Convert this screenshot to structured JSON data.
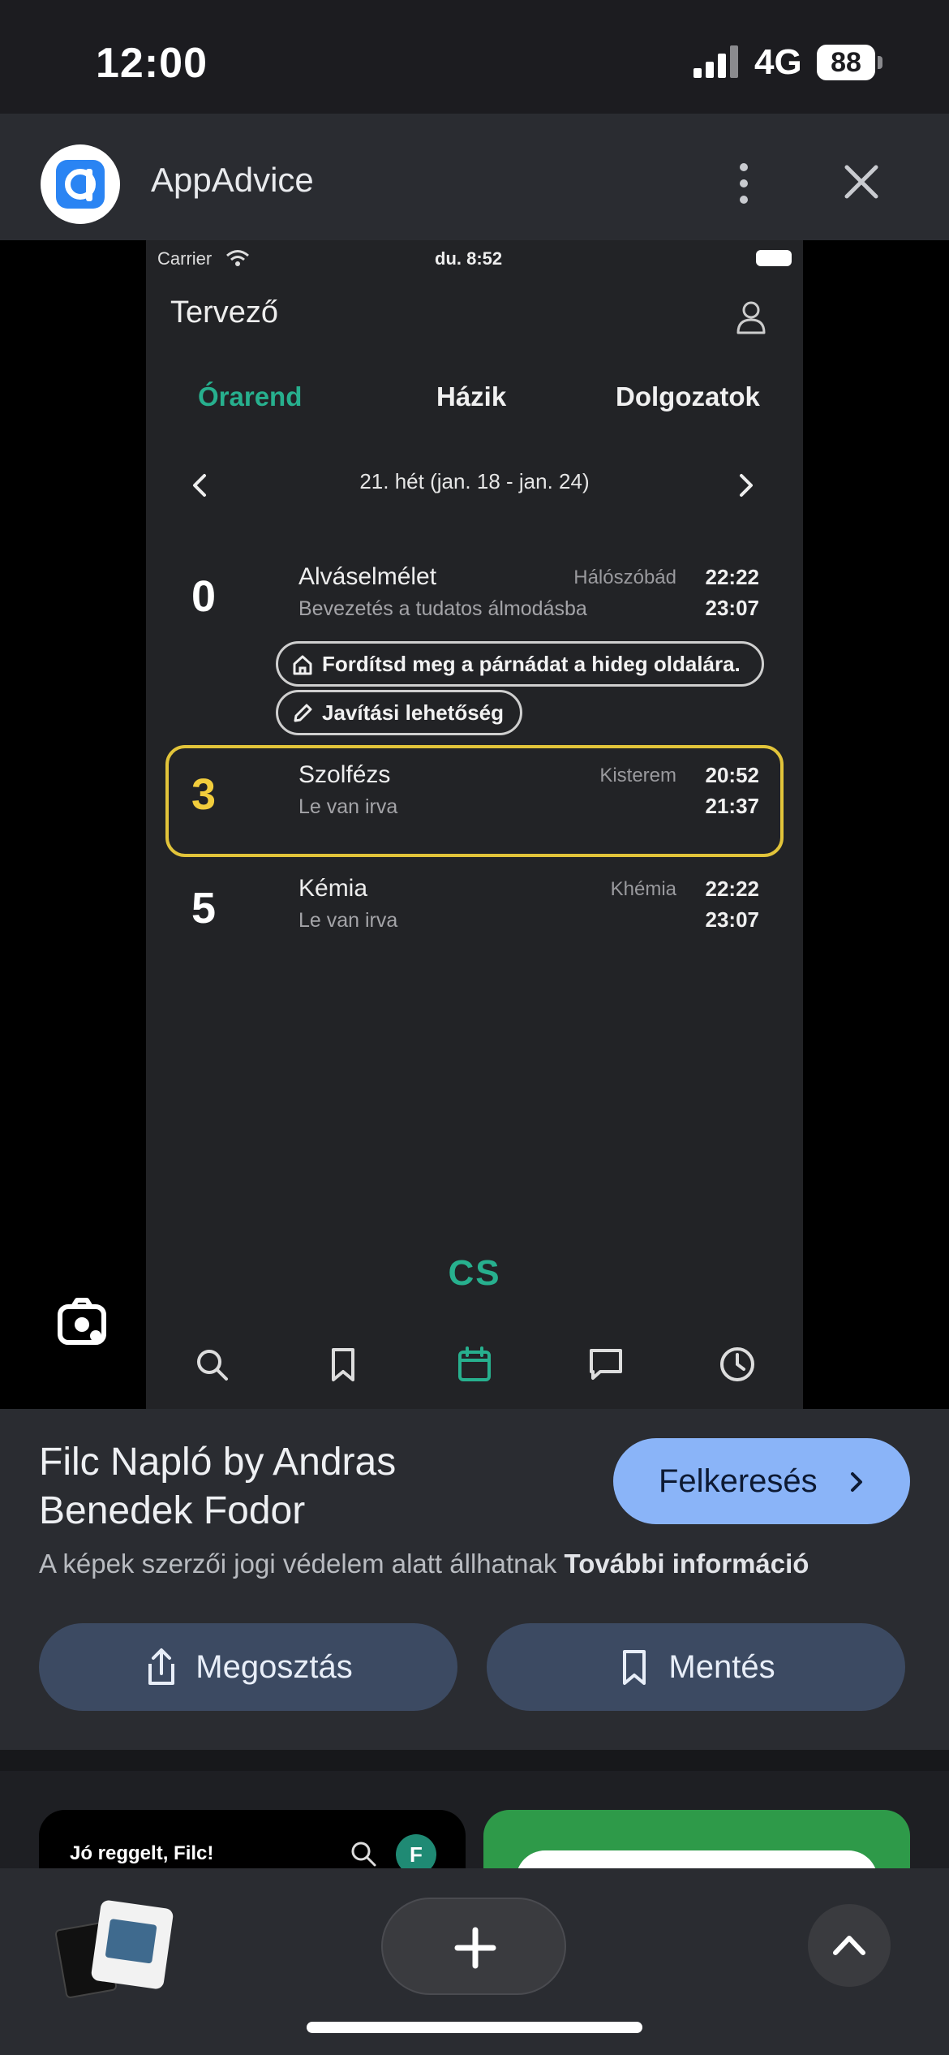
{
  "status_bar": {
    "time": "12:00",
    "network": "4G",
    "battery": "88"
  },
  "header": {
    "site_name": "AppAdvice",
    "logo_icon": "appadvice-logo",
    "menu_icon": "more-vert-icon",
    "close_icon": "close-icon"
  },
  "screenshot": {
    "status": {
      "carrier": "Carrier",
      "time": "du. 8:52"
    },
    "title": "Tervező",
    "tabs": [
      {
        "label": "Órarend",
        "active": true
      },
      {
        "label": "Házik",
        "active": false
      },
      {
        "label": "Dolgozatok",
        "active": false
      }
    ],
    "week_label": "21. hét (jan. 18 - jan. 24)",
    "lessons": [
      {
        "number": "0",
        "name": "Alváselmélet",
        "subtitle": "Bevezetés a tudatos álmodásba",
        "room": "Hálószóbád",
        "start": "22:22",
        "end": "23:07"
      },
      {
        "number": "3",
        "name": "Szolfézs",
        "subtitle": "Le van irva",
        "room": "Kisterem",
        "start": "20:52",
        "end": "21:37",
        "highlighted": true
      },
      {
        "number": "5",
        "name": "Kémia",
        "subtitle": "Le van irva",
        "room": "Khémia",
        "start": "22:22",
        "end": "23:07"
      }
    ],
    "chips": [
      {
        "label": "Fordítsd meg a párnádat a hideg oldalára.",
        "icon": "home-icon"
      },
      {
        "label": "Javítási lehetőség",
        "icon": "pencil-icon"
      }
    ],
    "center_label": "CS",
    "accent_color": "#27b08e",
    "highlight_color": "#e2c43a",
    "nav_icons": [
      "search-icon",
      "bookmark-icon",
      "calendar-icon",
      "chat-icon",
      "clock-icon"
    ],
    "active_nav": "calendar-icon"
  },
  "info": {
    "title": "Filc Napló by Andras Benedek Fodor",
    "visit_label": "Felkeresés",
    "copyright_text": "A képek szerzői jogi védelem alatt állhatnak ",
    "more_info": "További információ",
    "share_label": "Megosztás",
    "save_label": "Mentés",
    "button_color": "#8ab4f8"
  },
  "related": {
    "card1_text": "Jó reggelt, Filc!",
    "card1_avatar": "F"
  }
}
